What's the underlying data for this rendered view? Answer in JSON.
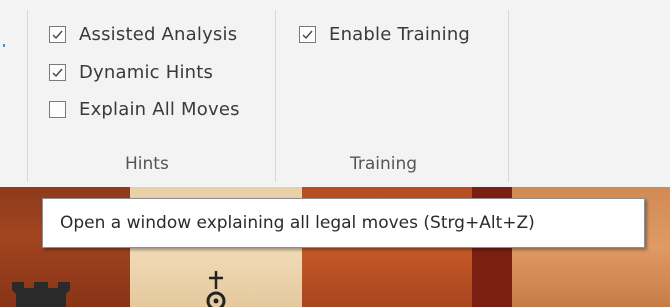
{
  "hints_group": {
    "label": "Hints",
    "options": [
      {
        "label": "Assisted Analysis",
        "checked": true
      },
      {
        "label": "Dynamic Hints",
        "checked": true
      },
      {
        "label": "Explain All Moves",
        "checked": false
      }
    ]
  },
  "training_group": {
    "label": "Training",
    "options": [
      {
        "label": "Enable Training",
        "checked": true
      }
    ]
  },
  "tooltip": {
    "text": "Open a window explaining all legal moves (Strg+Alt+Z)"
  },
  "board": {
    "pieces_visible": [
      "rook",
      "king"
    ]
  }
}
